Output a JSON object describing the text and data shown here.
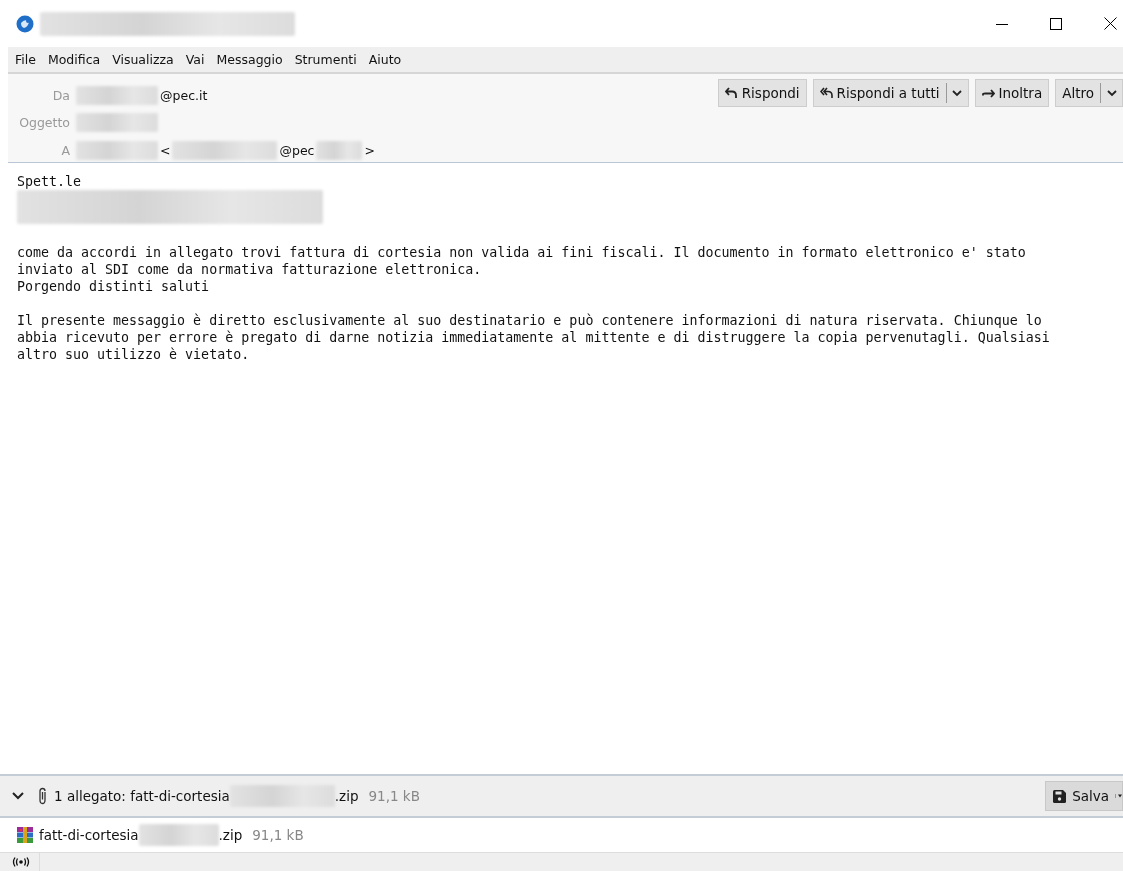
{
  "window": {
    "title": [
      {
        "kind": "redacted"
      }
    ]
  },
  "menu_bar": [
    "File",
    "Modifica",
    "Visualizza",
    "Vai",
    "Messaggio",
    "Strumenti",
    "Aiuto"
  ],
  "header": {
    "fields": [
      {
        "label": "Da",
        "value": [
          {
            "kind": "redacted"
          },
          {
            "kind": "text",
            "text": "@pec.it"
          }
        ]
      },
      {
        "label": "Oggetto",
        "value": [
          {
            "kind": "redacted"
          }
        ]
      },
      {
        "label": "A",
        "value": [
          {
            "kind": "redacted"
          },
          {
            "kind": "text",
            "text": "<"
          },
          {
            "kind": "redacted"
          },
          {
            "kind": "text",
            "text": "@pec"
          },
          {
            "kind": "redacted"
          },
          {
            "kind": "text",
            "text": ">"
          }
        ]
      }
    ],
    "buttons": [
      {
        "label": "Rispondi",
        "menu": false
      },
      {
        "label": "Rispondi a tutti",
        "menu": true
      },
      {
        "label": "Inoltra",
        "menu": false
      },
      {
        "label": "Altro",
        "menu": true
      }
    ]
  },
  "body": [
    {
      "kind": "text",
      "lines": [
        "Spett.le"
      ]
    },
    {
      "kind": "redacted"
    },
    {
      "kind": "text",
      "lines": [
        "come da accordi in allegato trovi fattura di cortesia non valida ai fini fiscali. Il documento in formato elettronico e' stato",
        "inviato al SDI come da normativa fatturazione elettronica.",
        "Porgendo distinti saluti"
      ]
    },
    {
      "kind": "text",
      "lines": [
        "Il presente messaggio è diretto esclusivamente al suo destinatario e può contenere informazioni di natura riservata. Chiunque lo",
        "abbia ricevuto per errore è pregato di darne notizia immediatamente al mittente e di distruggere la copia pervenutagli. Qualsiasi",
        "altro suo utilizzo è vietato."
      ]
    }
  ],
  "attachments": {
    "expanded": true,
    "summary": "1 allegato: fatt-di-cortesia",
    "extension": ".zip",
    "size": "91,1 kB",
    "save_button": "Salva",
    "items": [
      {
        "name": "fatt-di-cortesia",
        "extension": ".zip",
        "size": "91,1 kB"
      }
    ]
  }
}
